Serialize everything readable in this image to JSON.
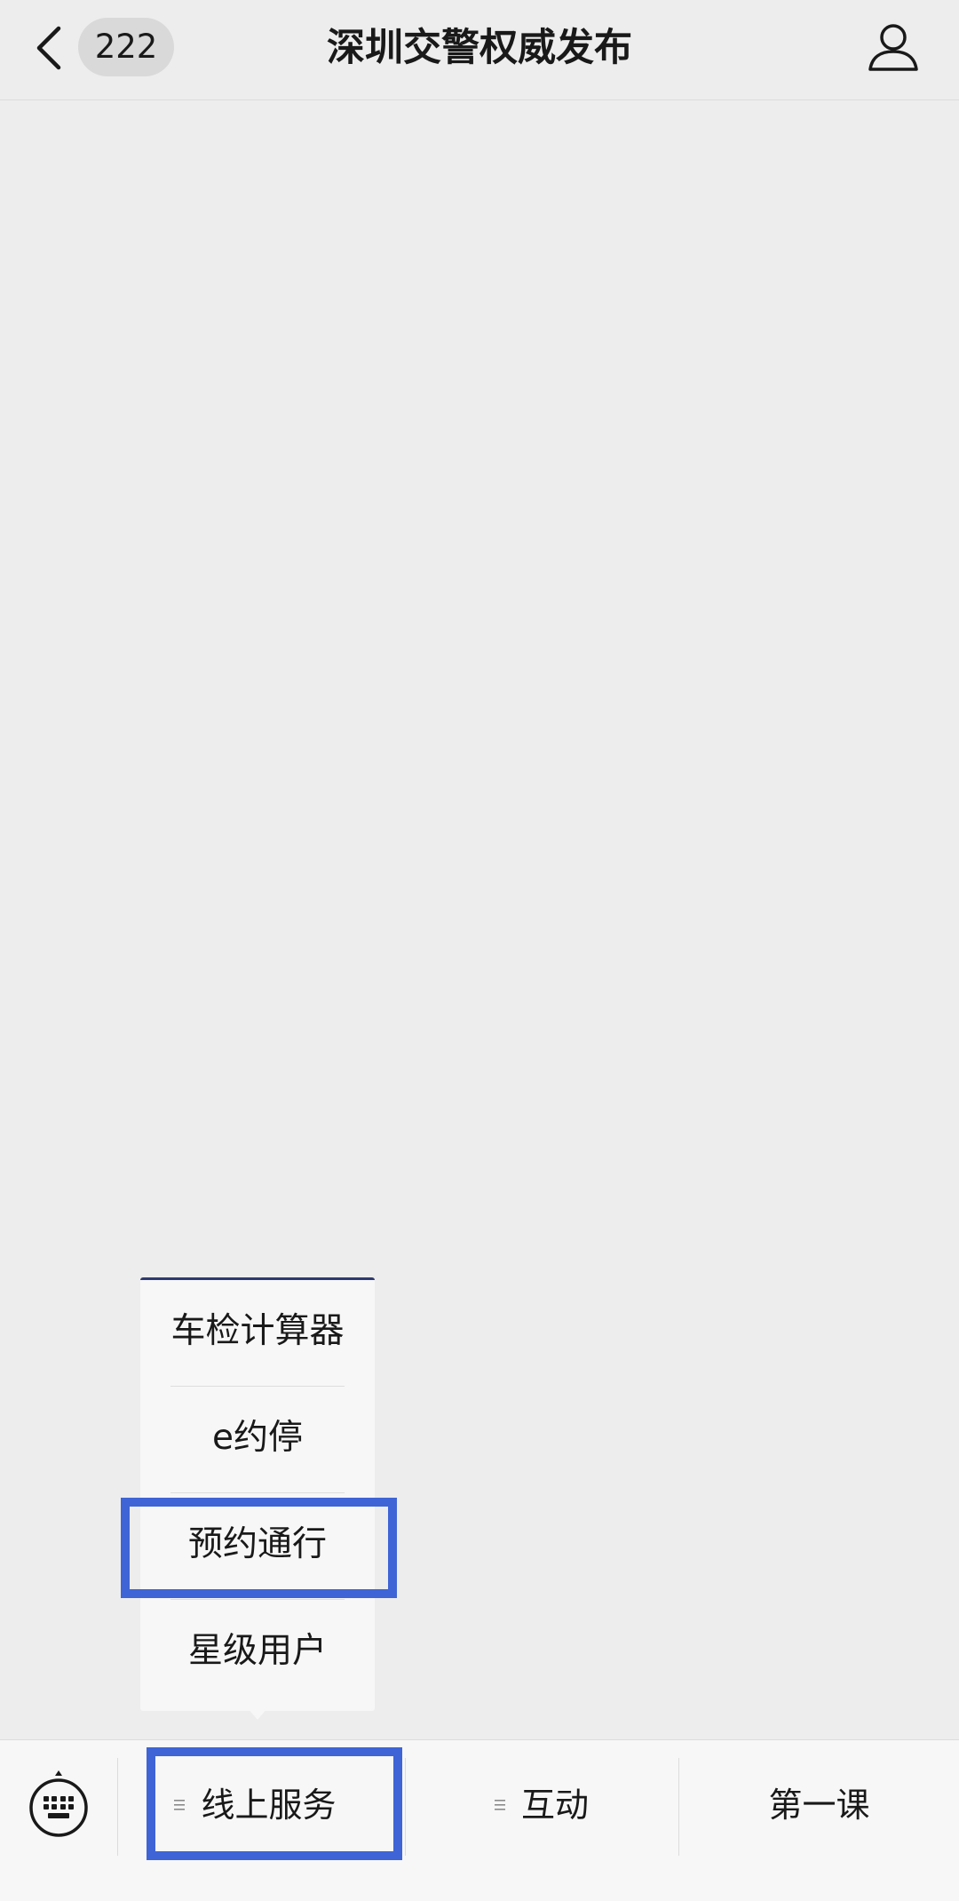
{
  "header": {
    "back_icon": "chevron-left-icon",
    "unread_count": "222",
    "title": "深圳交警权威发布",
    "profile_icon": "person-icon"
  },
  "popup_menu": {
    "items": [
      {
        "label": "车检计算器"
      },
      {
        "label": "e约停"
      },
      {
        "label": "预约通行",
        "highlighted": true
      },
      {
        "label": "星级用户"
      }
    ]
  },
  "bottom_menu": {
    "keyboard_icon": "keyboard-icon",
    "items": [
      {
        "label": "线上服务",
        "icon": "menu-lines-icon",
        "highlighted": true
      },
      {
        "label": "互动",
        "icon": "menu-lines-icon"
      },
      {
        "label": "第一课"
      }
    ]
  },
  "colors": {
    "background": "#ededed",
    "bar_background": "#f7f7f7",
    "highlight": "#3f64d6",
    "text": "#191919"
  }
}
